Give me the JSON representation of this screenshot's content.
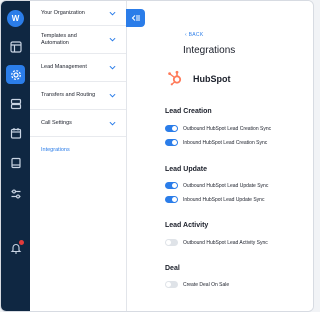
{
  "sidebar": {
    "icons": [
      "logo-icon",
      "dashboard-icon",
      "settings-icon",
      "database-icon",
      "calendar-icon",
      "book-icon",
      "routing-icon",
      "bell-icon"
    ]
  },
  "menu": {
    "items": [
      {
        "label": "Your Organization"
      },
      {
        "label": "Templates and Automation"
      },
      {
        "label": "Lead Management"
      },
      {
        "label": "Transfers and Routing"
      },
      {
        "label": "Call Settings"
      }
    ],
    "active_link": "Integrations"
  },
  "header": {
    "back_label": "BACK",
    "title": "Integrations"
  },
  "integration": {
    "name": "HubSpot",
    "logo_color": "#ff7a59"
  },
  "sections": [
    {
      "title": "Lead Creation",
      "toggles": [
        {
          "label": "Outbound HubSpot Lead Creation Sync",
          "on": true
        },
        {
          "label": "Inbound HubSpot Lead Creation Sync",
          "on": true
        }
      ]
    },
    {
      "title": "Lead Update",
      "toggles": [
        {
          "label": "Outbound HubSpot Lead Update Sync",
          "on": true
        },
        {
          "label": "Inbound HubSpot Lead Update Sync",
          "on": true
        }
      ]
    },
    {
      "title": "Lead Activity",
      "toggles": [
        {
          "label": "Outbound HubSpot Lead Activity Sync",
          "on": false
        }
      ]
    },
    {
      "title": "Deal",
      "toggles": [
        {
          "label": "Create Deal On Sale",
          "on": false
        }
      ]
    }
  ],
  "colors": {
    "accent": "#2b7de9",
    "rail": "#0f2742",
    "notification": "#e23b3b"
  }
}
